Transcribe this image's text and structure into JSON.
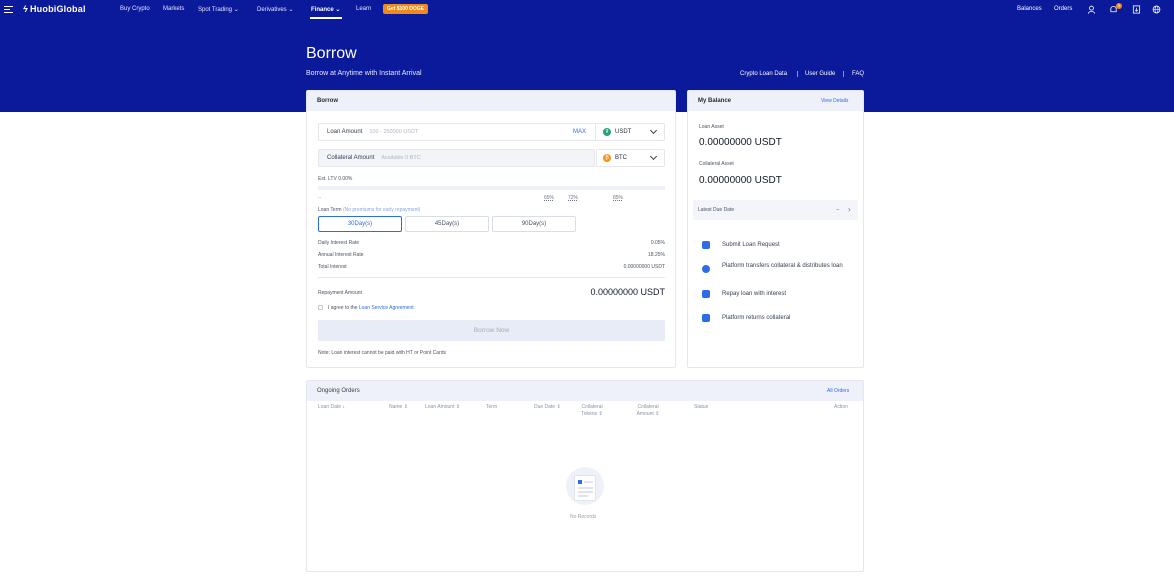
{
  "nav": {
    "logo": "HuobiGlobal",
    "items": [
      "Buy Crypto",
      "Markets",
      "Spot Trading",
      "Derivatives",
      "Finance",
      "Learn"
    ],
    "promo": "Get $100 DOGE",
    "right": [
      "Balances",
      "Orders"
    ],
    "notification_badge": "9"
  },
  "hero": {
    "title": "Borrow",
    "subtitle": "Borrow at Anytime with Instant Arrival",
    "links": [
      "Crypto Loan Data",
      "User Guide",
      "FAQ"
    ]
  },
  "borrow": {
    "title": "Borrow",
    "loan_label": "Loan Amount",
    "loan_placeholder": "100 - 250000 USDT",
    "max": "MAX",
    "loan_coin": "USDT",
    "collateral_label": "Collateral Amount",
    "collateral_placeholder": "Available 0 BTC",
    "collateral_coin": "BTC",
    "ltv_label": "Est. LTV 0.00%",
    "ltv_dash": "--",
    "ltv_marks": [
      "65%",
      "72%",
      "85%"
    ],
    "term_label": "Loan Term",
    "term_note": "(No premiums for early repayment)",
    "terms": [
      "30Day(s)",
      "45Day(s)",
      "90Day(s)"
    ],
    "selected_term": "30Day(s)",
    "rows": [
      {
        "label": "Daily Interest Rate",
        "value": "0.05%"
      },
      {
        "label": "Annual Interest Rate",
        "value": "18.25%"
      },
      {
        "label": "Total Interest",
        "value": "0.00000000 USDT"
      }
    ],
    "repayment_label": "Repayment Amount",
    "repayment_value": "0.00000000 USDT",
    "agree_prefix": "I agree to the",
    "agree_link": "Loan Service Agreement",
    "button": "Borrow Now",
    "note": "Note: Loan interest cannot be paid with HT or Point Cards"
  },
  "balance": {
    "title": "My Balance",
    "view_details": "View Details",
    "loan_asset_label": "Loan Asset",
    "loan_asset_value": "0.00000000 USDT",
    "collateral_asset_label": "Collateral Asset",
    "collateral_asset_value": "0.00000000 USDT",
    "due_label": "Latest Due Date",
    "due_value": "--",
    "steps": [
      "Submit Loan Request",
      "Platform transfers collateral & distributes loan",
      "Repay loan with interest",
      "Platform returns collateral"
    ]
  },
  "orders": {
    "title": "Ongoing Orders",
    "all_orders": "All Orders",
    "columns": [
      "Loan Date",
      "Name",
      "Loan Amount",
      "Term",
      "Due Date",
      "Collateral Tokens",
      "Collateral Amount",
      "Status",
      "Action"
    ],
    "empty": "No Records"
  },
  "colors": {
    "brand_blue": "#0a1a9a",
    "accent": "#2e6be6",
    "promo": "#f08a1c",
    "usdt": "#26a17b",
    "btc": "#f7931a"
  }
}
